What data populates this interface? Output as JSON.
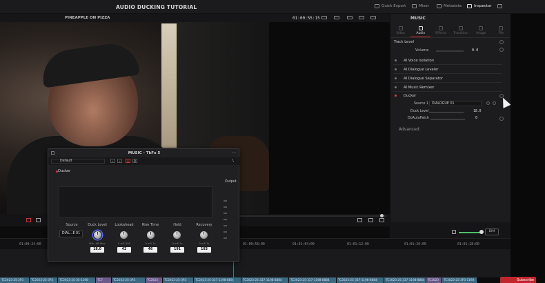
{
  "app": {
    "title": "AUDIO DUCKING TUTORIAL"
  },
  "topbar": {
    "quick_export": "Quick Export",
    "mixer": "Mixer",
    "metadata": "Metadata",
    "inspector": "Inspector"
  },
  "viewer": {
    "clip_name": "PINEAPPLE ON PIZZA",
    "timecode": "01:00:55:15"
  },
  "inspector": {
    "track_name": "MUSIC",
    "tabs": [
      "Video",
      "Audio",
      "Effects",
      "Transition",
      "Image",
      "File"
    ],
    "active_tab": "Audio",
    "track_level_title": "Track Level",
    "volume_label": "Volume",
    "volume_value": "0.0",
    "effects": [
      {
        "name": "AI Voice Isolation",
        "on": false
      },
      {
        "name": "AI Dialogue Leveler",
        "on": false
      },
      {
        "name": "AI Dialogue Separator",
        "on": false
      },
      {
        "name": "AI Music Remixer",
        "on": false
      },
      {
        "name": "Ducker",
        "on": true
      }
    ],
    "ducker": {
      "source_label": "Source 1",
      "source_value": "DIALOGUE 01",
      "duck_level_label": "Duck Level",
      "duck_level_value": "18.0",
      "autopatch_label": "DoAutoPatch",
      "autopatch_value": "0"
    },
    "advanced_label": "Advanced"
  },
  "audio_controls": {
    "dim_label": "DIM"
  },
  "timeline": {
    "ticks": [
      "01:00:24:00",
      "01:00:56:00",
      "01:01:04:00",
      "01:01:12:00",
      "01:01:20:00",
      "01:01:28:00"
    ],
    "clips": [
      "TC2023-25-2P3",
      "TC2023-25-3P3",
      "TC2023-25-35-1198",
      "TC7",
      "TC2023-25-3P3",
      "TC2023",
      "TC2023-25-3P3",
      "TC2023-25-337-1198-8884",
      "TC2023-25-337-1198-8884",
      "TC2023-25-337-1198-8884",
      "TC2023-25-337-1198-8884",
      "TC2023-25-337-1198-8884",
      "TC2023",
      "TC2023-25-3P3-1198"
    ],
    "subscribe": "Subscribe"
  },
  "plugin": {
    "title": "MUSIC - TkFx 5",
    "preset": "Default",
    "section": "Ducker",
    "output_label": "Output",
    "controls": {
      "source": {
        "label": "Source",
        "value": "DIAL...E 01"
      },
      "duck_level": {
        "label": "Duck Level",
        "scale": "Min  -dB  Max",
        "value": "18.0"
      },
      "lookahead": {
        "label": "Lookahead",
        "scale": "0    mS  500",
        "value": "42"
      },
      "rise_time": {
        "label": "Rise Time",
        "scale": "0    mS   1s",
        "value": "46"
      },
      "hold": {
        "label": "Hold",
        "scale": "0    mS   1s",
        "value": "191"
      },
      "recovery": {
        "label": "Recovery",
        "scale": "0    mS   1s",
        "value": "183"
      }
    }
  },
  "colors": {
    "accent_red": "#d33333",
    "knob_ring": "#5a6cff",
    "volume_green": "#4fbf6a"
  }
}
